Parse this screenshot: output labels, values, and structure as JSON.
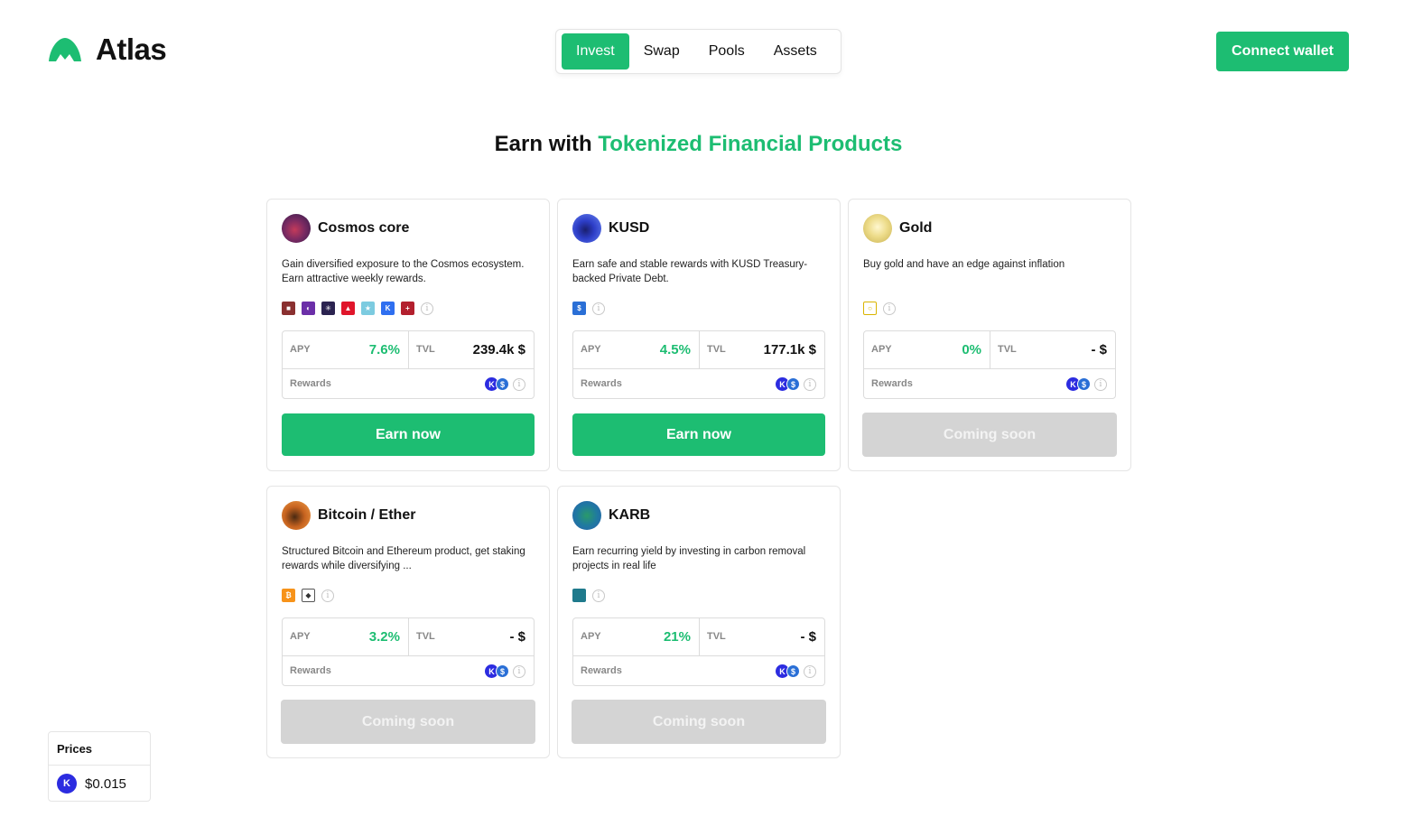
{
  "brand": {
    "name": "Atlas",
    "logo_icon": "mountain-icon",
    "accent_color": "#1dbd72"
  },
  "nav": {
    "tabs": [
      {
        "label": "Invest",
        "active": true
      },
      {
        "label": "Swap",
        "active": false
      },
      {
        "label": "Pools",
        "active": false
      },
      {
        "label": "Assets",
        "active": false
      }
    ]
  },
  "header": {
    "connect_label": "Connect wallet"
  },
  "headline": {
    "prefix": "Earn with",
    "accent": "Tokenized Financial Products"
  },
  "cards": [
    {
      "title": "Cosmos core",
      "description": "Gain diversified exposure to the Cosmos ecosystem. Earn attractive weekly rewards.",
      "apy_label": "APY",
      "apy": "7.6%",
      "tvl_label": "TVL",
      "tvl": "239.4k $",
      "rewards_label": "Rewards",
      "button": "Earn now",
      "button_state": "active"
    },
    {
      "title": "KUSD",
      "description": "Earn safe and stable rewards with KUSD Treasury-backed Private Debt.",
      "apy_label": "APY",
      "apy": "4.5%",
      "tvl_label": "TVL",
      "tvl": "177.1k $",
      "rewards_label": "Rewards",
      "button": "Earn now",
      "button_state": "active"
    },
    {
      "title": "Gold",
      "description": "Buy gold and have an edge against inflation",
      "apy_label": "APY",
      "apy": "0%",
      "tvl_label": "TVL",
      "tvl": "- $",
      "rewards_label": "Rewards",
      "button": "Coming soon",
      "button_state": "disabled"
    },
    {
      "title": "Bitcoin / Ether",
      "description": "Structured Bitcoin and Ethereum product, get staking rewards while diversifying ...",
      "apy_label": "APY",
      "apy": "3.2%",
      "tvl_label": "TVL",
      "tvl": "- $",
      "rewards_label": "Rewards",
      "button": "Coming soon",
      "button_state": "disabled"
    },
    {
      "title": "KARB",
      "description": "Earn recurring yield by investing in carbon removal projects in real life",
      "apy_label": "APY",
      "apy": "21%",
      "tvl_label": "TVL",
      "tvl": "- $",
      "rewards_label": "Rewards",
      "button": "Coming soon",
      "button_state": "disabled"
    }
  ],
  "prices": {
    "title": "Prices",
    "token_icon": "kujira-token-icon",
    "value": "$0.015"
  }
}
